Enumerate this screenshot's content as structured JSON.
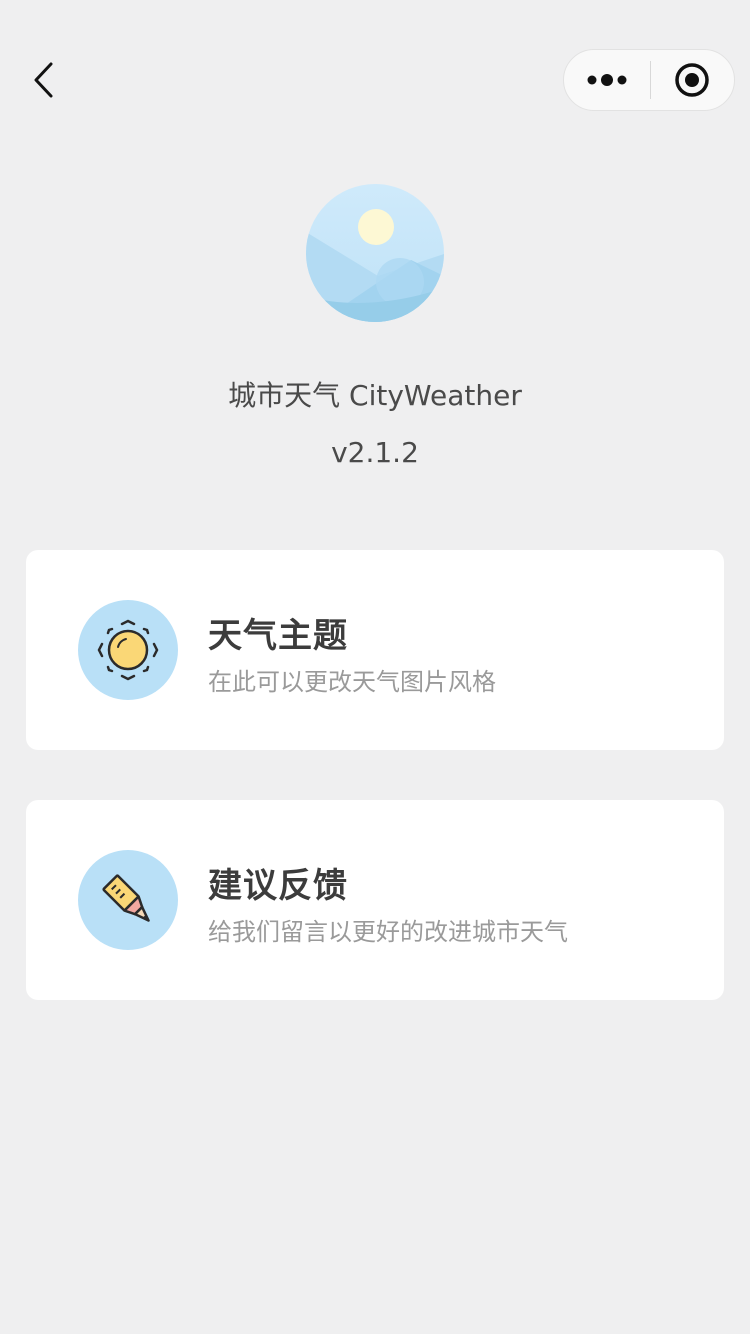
{
  "nav": {
    "back_icon": "chevron-left-icon",
    "more_icon": "more-dots-icon",
    "close_icon": "target-close-icon"
  },
  "app": {
    "name": "城市天气 CityWeather",
    "version": "v2.1.2",
    "logo_icon": "landscape-sun-logo"
  },
  "cards": [
    {
      "title": "天气主题",
      "subtitle": "在此可以更改天气图片风格",
      "icon": "sun-icon"
    },
    {
      "title": "建议反馈",
      "subtitle": "给我们留言以更好的改进城市天气",
      "icon": "pencil-icon"
    }
  ],
  "colors": {
    "background": "#efeff0",
    "card": "#ffffff",
    "icon_circle": "#b9e0f7",
    "sun_fill": "#fad776",
    "title_text": "#3c3c3c",
    "subtitle_text": "#9a9a9a"
  }
}
